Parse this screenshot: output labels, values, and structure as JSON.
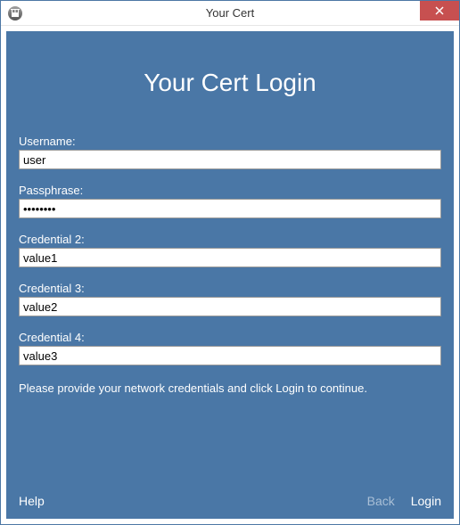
{
  "window": {
    "title": "Your Cert"
  },
  "panel": {
    "heading": "Your Cert Login",
    "instruction": "Please provide your network credentials and click Login to continue."
  },
  "fields": {
    "username": {
      "label": "Username:",
      "value": "user"
    },
    "passphrase": {
      "label": "Passphrase:",
      "value": "••••••••"
    },
    "cred2": {
      "label": "Credential 2:",
      "value": "value1"
    },
    "cred3": {
      "label": "Credential 3:",
      "value": "value2"
    },
    "cred4": {
      "label": "Credential 4:",
      "value": "value3"
    }
  },
  "footer": {
    "help": "Help",
    "back": "Back",
    "login": "Login"
  },
  "colors": {
    "panel_bg": "#4a77a6",
    "close_bg": "#c75050"
  }
}
